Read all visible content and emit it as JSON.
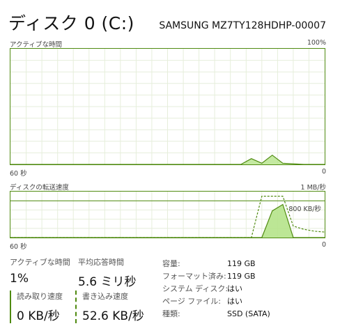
{
  "header": {
    "title": "ディスク 0 (C:)",
    "model": "SAMSUNG MZ7TY128HDHP-00007"
  },
  "active_chart": {
    "title": "アクティブな時間",
    "max_label": "100%",
    "time_label": "60 秒",
    "min_label": "0"
  },
  "transfer_chart": {
    "title": "ディスクの転送速度",
    "max_label": "1 MB/秒",
    "mid_label": "800 KB/秒",
    "time_label": "60 秒",
    "min_label": "0"
  },
  "stats": {
    "active_time_label": "アクティブな時間",
    "active_time_value": "1%",
    "response_label": "平均応答時間",
    "response_value": "5.6 ミリ秒",
    "read_label": "読み取り速度",
    "read_value": "0 KB/秒",
    "write_label": "書き込み速度",
    "write_value": "52.6 KB/秒"
  },
  "properties": [
    {
      "key": "容量:",
      "value": "119 GB"
    },
    {
      "key": "フォーマット済み:",
      "value": "119 GB"
    },
    {
      "key": "システム ディスク:",
      "value": "はい"
    },
    {
      "key": "ページ ファイル:",
      "value": "はい"
    },
    {
      "key": "種類:",
      "value": "SSD (SATA)"
    }
  ],
  "colors": {
    "accent": "#4f8a10",
    "fill": "#b5e38a",
    "grid": "#e6eedb"
  },
  "chart_data": [
    {
      "type": "area",
      "title": "アクティブな時間",
      "xlabel": "60 秒",
      "ylim": [
        0,
        100
      ],
      "x": [
        60,
        56,
        52,
        48,
        44,
        40,
        36,
        32,
        28,
        24,
        20,
        16,
        14,
        12,
        10,
        8,
        4,
        0
      ],
      "series": [
        {
          "values": [
            0,
            0,
            0,
            0,
            0,
            0,
            0,
            0,
            0,
            0,
            0,
            0,
            5,
            1,
            8,
            1,
            0,
            0
          ]
        }
      ]
    },
    {
      "type": "line",
      "title": "ディスクの転送速度",
      "xlabel": "60 秒",
      "ylabel": "KB/秒",
      "ylim": [
        0,
        1000
      ],
      "x": [
        60,
        56,
        52,
        48,
        44,
        40,
        36,
        32,
        28,
        24,
        20,
        18,
        16,
        14,
        12,
        10,
        8,
        6,
        4,
        2,
        0
      ],
      "series": [
        {
          "values": [
            0,
            0,
            0,
            0,
            0,
            0,
            0,
            0,
            0,
            0,
            0,
            0,
            0,
            0,
            0,
            580,
            720,
            0,
            0,
            0,
            0
          ]
        },
        {
          "values": [
            0,
            0,
            0,
            0,
            0,
            0,
            0,
            0,
            0,
            0,
            0,
            0,
            0,
            0,
            900,
            900,
            900,
            250,
            180,
            140,
            120
          ]
        }
      ]
    }
  ]
}
